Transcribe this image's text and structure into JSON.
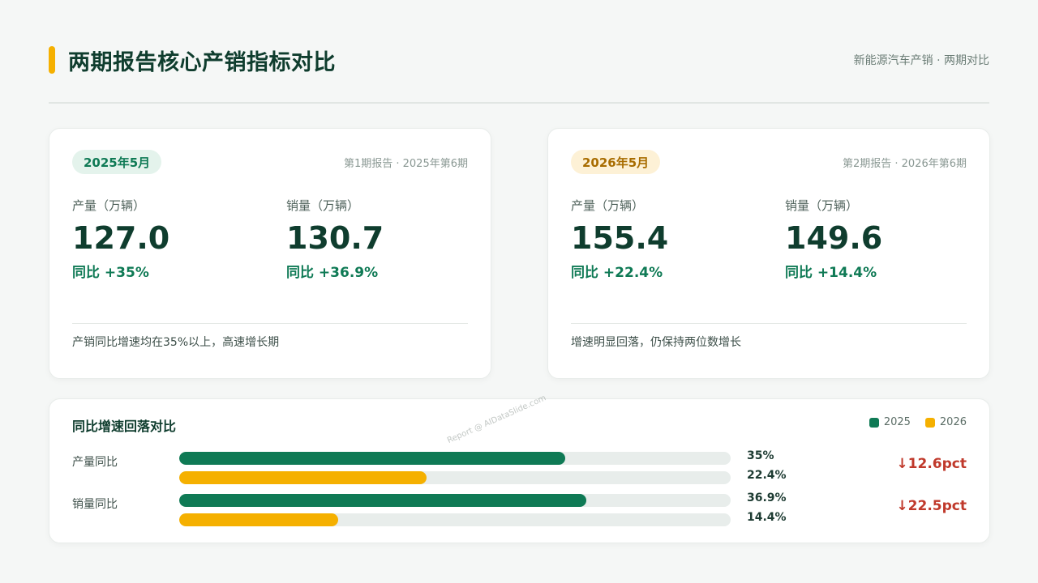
{
  "header": {
    "title": "两期报告核心产销指标对比",
    "subtitle": "新能源汽车产销 · 两期对比"
  },
  "cards": [
    {
      "badge": "2025年5月",
      "report_ref": "第1期报告 · 2025年第6期",
      "production": {
        "label": "产量（万辆）",
        "value": "127.0",
        "yoy": "同比 +35%"
      },
      "sales": {
        "label": "销量（万辆）",
        "value": "130.7",
        "yoy": "同比 +36.9%"
      },
      "note": "产销同比增速均在35%以上，高速增长期"
    },
    {
      "badge": "2026年5月",
      "report_ref": "第2期报告 · 2026年第6期",
      "production": {
        "label": "产量（万辆）",
        "value": "155.4",
        "yoy": "同比 +22.4%"
      },
      "sales": {
        "label": "销量（万辆）",
        "value": "149.6",
        "yoy": "同比 +14.4%"
      },
      "note": "增速明显回落，仍保持两位数增长"
    }
  ],
  "comparison": {
    "title": "同比增速回落对比",
    "legend": [
      "2025",
      "2026"
    ],
    "rows": [
      {
        "label": "产量同比",
        "value_2025_text": "35%",
        "value_2026_text": "22.4%",
        "delta": "↓12.6pct"
      },
      {
        "label": "销量同比",
        "value_2025_text": "36.9%",
        "value_2026_text": "14.4%",
        "delta": "↓22.5pct"
      }
    ]
  },
  "watermark": "Report @ AIDataSlide.com",
  "colors": {
    "accent_green": "#0f7a55",
    "accent_amber": "#f5b000",
    "title_dark": "#0f3d2e",
    "delta_red": "#c0392b"
  },
  "chart_data": {
    "type": "bar",
    "orientation": "horizontal",
    "categories": [
      "产量同比",
      "销量同比"
    ],
    "series": [
      {
        "name": "2025",
        "values": [
          35,
          36.9
        ]
      },
      {
        "name": "2026",
        "values": [
          22.4,
          14.4
        ]
      }
    ],
    "xlim": [
      0,
      50
    ],
    "unit": "%",
    "legend_position": "top-right",
    "grid": false
  }
}
